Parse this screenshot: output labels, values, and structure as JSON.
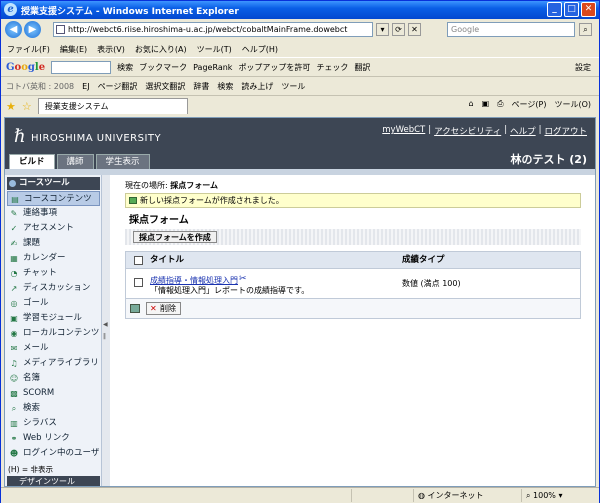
{
  "window": {
    "title": "授業支援システム - Windows Internet Explorer"
  },
  "address": {
    "url": "http://webct6.riise.hiroshima-u.ac.jp/webct/cobaltMainFrame.dowebct",
    "search_placeholder": "Google"
  },
  "menu": [
    "ファイル(F)",
    "編集(E)",
    "表示(V)",
    "お気に入り(A)",
    "ツール(T)",
    "ヘルプ(H)"
  ],
  "google_toolbar": {
    "logo_g": "G",
    "logo_o1": "o",
    "logo_o2": "o",
    "logo_g2": "g",
    "logo_l": "l",
    "logo_e": "e",
    "items": [
      "検索",
      "ブックマーク",
      "PageRank",
      "ポップアップを許可",
      "チェック",
      "翻訳",
      "設定"
    ]
  },
  "translate_toolbar": {
    "label": "コトバ英和 : 2008",
    "items": [
      "EJ",
      "ページ翻訳",
      "選択文翻訳",
      "辞書",
      "検索",
      "読み上げ",
      "ツール"
    ]
  },
  "tabbar": {
    "tab_title": "授業支援システム",
    "right_items": [
      "ページ(P)",
      "ツール(O)"
    ]
  },
  "header": {
    "university": "HIROSHIMA UNIVERSITY",
    "links": [
      "myWebCT",
      "アクセシビリティ",
      "ヘルプ",
      "ログアウト"
    ],
    "user": "林のテスト (2)",
    "tabs": [
      "ビルド",
      "講師",
      "学生表示"
    ]
  },
  "leftnav": {
    "heading": "コースツール",
    "items": [
      "コースコンテンツ",
      "連絡事項",
      "アセスメント",
      "課題",
      "カレンダー",
      "チャット",
      "ディスカッション",
      "ゴール",
      "学習モジュール",
      "ローカルコンテンツ",
      "メール",
      "メディアライブラリ",
      "名簿",
      "SCORM",
      "検索",
      "シラバス",
      "Web リンク",
      "ログイン中のユーザ"
    ],
    "footnote": "(H) = 非表示",
    "heading2": "デザインツール"
  },
  "main": {
    "breadcrumb_label": "現在の場所:",
    "breadcrumb_current": "採点フォーム",
    "message": "新しい採点フォームが作成されました。",
    "title": "採点フォーム",
    "create_button": "採点フォームを作成",
    "col_title": "タイトル",
    "col_type": "成績タイプ",
    "row_link": "成績指導・情報処理入門",
    "row_desc": "「情報処理入門」レポートの成績指導です。",
    "row_type": "数値 (満点 100)",
    "delete_button": "削除"
  },
  "statusbar": {
    "zone": "インターネット",
    "zoom": "100%"
  }
}
